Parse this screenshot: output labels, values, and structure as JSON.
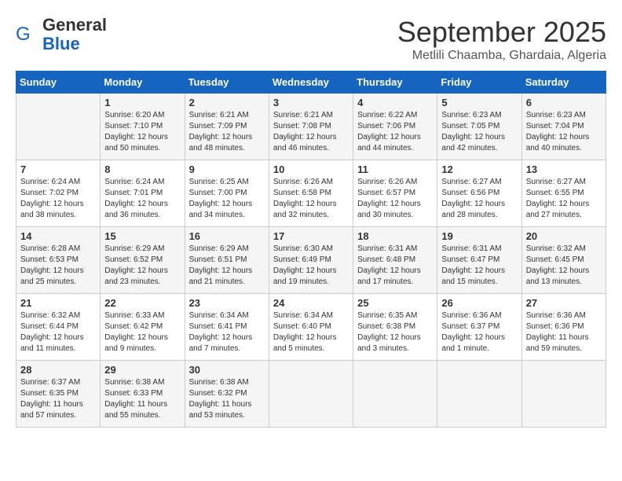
{
  "header": {
    "logo_line1": "General",
    "logo_line2": "Blue",
    "month": "September 2025",
    "location": "Metlili Chaamba, Ghardaia, Algeria"
  },
  "days_of_week": [
    "Sunday",
    "Monday",
    "Tuesday",
    "Wednesday",
    "Thursday",
    "Friday",
    "Saturday"
  ],
  "weeks": [
    [
      {
        "day": "",
        "content": ""
      },
      {
        "day": "1",
        "content": "Sunrise: 6:20 AM\nSunset: 7:10 PM\nDaylight: 12 hours\nand 50 minutes."
      },
      {
        "day": "2",
        "content": "Sunrise: 6:21 AM\nSunset: 7:09 PM\nDaylight: 12 hours\nand 48 minutes."
      },
      {
        "day": "3",
        "content": "Sunrise: 6:21 AM\nSunset: 7:08 PM\nDaylight: 12 hours\nand 46 minutes."
      },
      {
        "day": "4",
        "content": "Sunrise: 6:22 AM\nSunset: 7:06 PM\nDaylight: 12 hours\nand 44 minutes."
      },
      {
        "day": "5",
        "content": "Sunrise: 6:23 AM\nSunset: 7:05 PM\nDaylight: 12 hours\nand 42 minutes."
      },
      {
        "day": "6",
        "content": "Sunrise: 6:23 AM\nSunset: 7:04 PM\nDaylight: 12 hours\nand 40 minutes."
      }
    ],
    [
      {
        "day": "7",
        "content": "Sunrise: 6:24 AM\nSunset: 7:02 PM\nDaylight: 12 hours\nand 38 minutes."
      },
      {
        "day": "8",
        "content": "Sunrise: 6:24 AM\nSunset: 7:01 PM\nDaylight: 12 hours\nand 36 minutes."
      },
      {
        "day": "9",
        "content": "Sunrise: 6:25 AM\nSunset: 7:00 PM\nDaylight: 12 hours\nand 34 minutes."
      },
      {
        "day": "10",
        "content": "Sunrise: 6:26 AM\nSunset: 6:58 PM\nDaylight: 12 hours\nand 32 minutes."
      },
      {
        "day": "11",
        "content": "Sunrise: 6:26 AM\nSunset: 6:57 PM\nDaylight: 12 hours\nand 30 minutes."
      },
      {
        "day": "12",
        "content": "Sunrise: 6:27 AM\nSunset: 6:56 PM\nDaylight: 12 hours\nand 28 minutes."
      },
      {
        "day": "13",
        "content": "Sunrise: 6:27 AM\nSunset: 6:55 PM\nDaylight: 12 hours\nand 27 minutes."
      }
    ],
    [
      {
        "day": "14",
        "content": "Sunrise: 6:28 AM\nSunset: 6:53 PM\nDaylight: 12 hours\nand 25 minutes."
      },
      {
        "day": "15",
        "content": "Sunrise: 6:29 AM\nSunset: 6:52 PM\nDaylight: 12 hours\nand 23 minutes."
      },
      {
        "day": "16",
        "content": "Sunrise: 6:29 AM\nSunset: 6:51 PM\nDaylight: 12 hours\nand 21 minutes."
      },
      {
        "day": "17",
        "content": "Sunrise: 6:30 AM\nSunset: 6:49 PM\nDaylight: 12 hours\nand 19 minutes."
      },
      {
        "day": "18",
        "content": "Sunrise: 6:31 AM\nSunset: 6:48 PM\nDaylight: 12 hours\nand 17 minutes."
      },
      {
        "day": "19",
        "content": "Sunrise: 6:31 AM\nSunset: 6:47 PM\nDaylight: 12 hours\nand 15 minutes."
      },
      {
        "day": "20",
        "content": "Sunrise: 6:32 AM\nSunset: 6:45 PM\nDaylight: 12 hours\nand 13 minutes."
      }
    ],
    [
      {
        "day": "21",
        "content": "Sunrise: 6:32 AM\nSunset: 6:44 PM\nDaylight: 12 hours\nand 11 minutes."
      },
      {
        "day": "22",
        "content": "Sunrise: 6:33 AM\nSunset: 6:42 PM\nDaylight: 12 hours\nand 9 minutes."
      },
      {
        "day": "23",
        "content": "Sunrise: 6:34 AM\nSunset: 6:41 PM\nDaylight: 12 hours\nand 7 minutes."
      },
      {
        "day": "24",
        "content": "Sunrise: 6:34 AM\nSunset: 6:40 PM\nDaylight: 12 hours\nand 5 minutes."
      },
      {
        "day": "25",
        "content": "Sunrise: 6:35 AM\nSunset: 6:38 PM\nDaylight: 12 hours\nand 3 minutes."
      },
      {
        "day": "26",
        "content": "Sunrise: 6:36 AM\nSunset: 6:37 PM\nDaylight: 12 hours\nand 1 minute."
      },
      {
        "day": "27",
        "content": "Sunrise: 6:36 AM\nSunset: 6:36 PM\nDaylight: 11 hours\nand 59 minutes."
      }
    ],
    [
      {
        "day": "28",
        "content": "Sunrise: 6:37 AM\nSunset: 6:35 PM\nDaylight: 11 hours\nand 57 minutes."
      },
      {
        "day": "29",
        "content": "Sunrise: 6:38 AM\nSunset: 6:33 PM\nDaylight: 11 hours\nand 55 minutes."
      },
      {
        "day": "30",
        "content": "Sunrise: 6:38 AM\nSunset: 6:32 PM\nDaylight: 11 hours\nand 53 minutes."
      },
      {
        "day": "",
        "content": ""
      },
      {
        "day": "",
        "content": ""
      },
      {
        "day": "",
        "content": ""
      },
      {
        "day": "",
        "content": ""
      }
    ]
  ]
}
